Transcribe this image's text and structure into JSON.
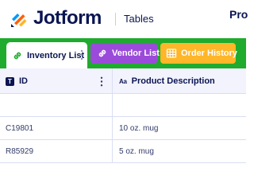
{
  "header": {
    "brand": "Jotform",
    "product": "Tables",
    "title_partial": "Pro"
  },
  "tabs": [
    {
      "label": "Inventory List",
      "icon": "link-icon",
      "color": "#ffffff",
      "active": true
    },
    {
      "label": "Vendor List",
      "icon": "link-icon",
      "color": "#9b4bd9",
      "active": false
    },
    {
      "label": "Order History",
      "icon": "table-icon",
      "color": "#ffb629",
      "active": false
    }
  ],
  "tabbar_color": "#1fab2d",
  "table": {
    "columns": [
      {
        "label": "ID",
        "type_icon": "text-type-icon"
      },
      {
        "label": "Product Description",
        "type_icon": "long-text-type-icon"
      }
    ],
    "type_glyphs": {
      "text": "T",
      "long_text": "Aa"
    },
    "rows": [
      {
        "id": "",
        "description": ""
      },
      {
        "id": "C19801",
        "description": "10 oz. mug"
      },
      {
        "id": "R85929",
        "description": "5 oz. mug"
      }
    ]
  }
}
